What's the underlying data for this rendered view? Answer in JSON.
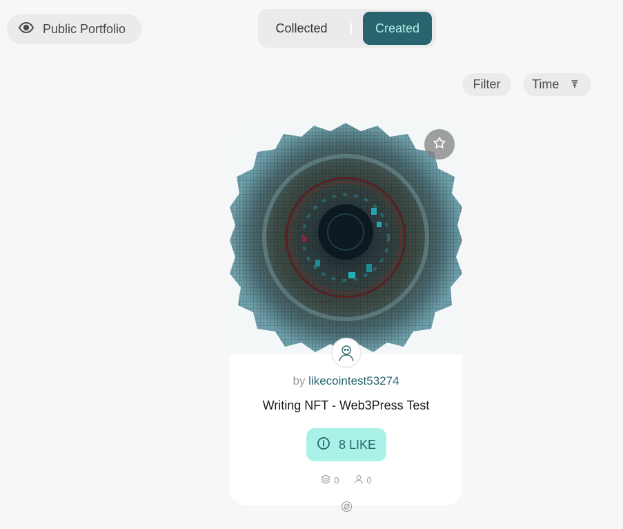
{
  "portfolio": {
    "label": "Public Portfolio",
    "icon": "eye-icon"
  },
  "tabs": {
    "collected": "Collected",
    "created": "Created",
    "active": "created"
  },
  "toolbar": {
    "filter_label": "Filter",
    "sort_label": "Time",
    "sort_icon": "sort-icon"
  },
  "card": {
    "by_prefix": "by",
    "author": "likecointest53274",
    "title": "Writing NFT - Web3Press Test",
    "price": "8 LIKE",
    "price_icon": "likecoin-icon",
    "collected_count": "0",
    "owners_count": "0",
    "favorite_icon": "star-icon"
  },
  "colors": {
    "accent_dark": "#28646e",
    "accent_light": "#aaf1e7",
    "background": "#f7f7f7",
    "pill_bg": "#ebebeb"
  }
}
